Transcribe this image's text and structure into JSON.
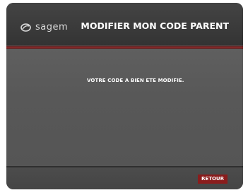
{
  "header": {
    "brand": "sagem",
    "title": "MODIFIER MON CODE PARENT"
  },
  "content": {
    "message": "VOTRE CODE A BIEN ETE MODIFIE."
  },
  "footer": {
    "retour_label": "RETOUR"
  },
  "colors": {
    "accent": "#8a1c1c",
    "background": "#5b5b5b",
    "text": "#ffffff"
  }
}
